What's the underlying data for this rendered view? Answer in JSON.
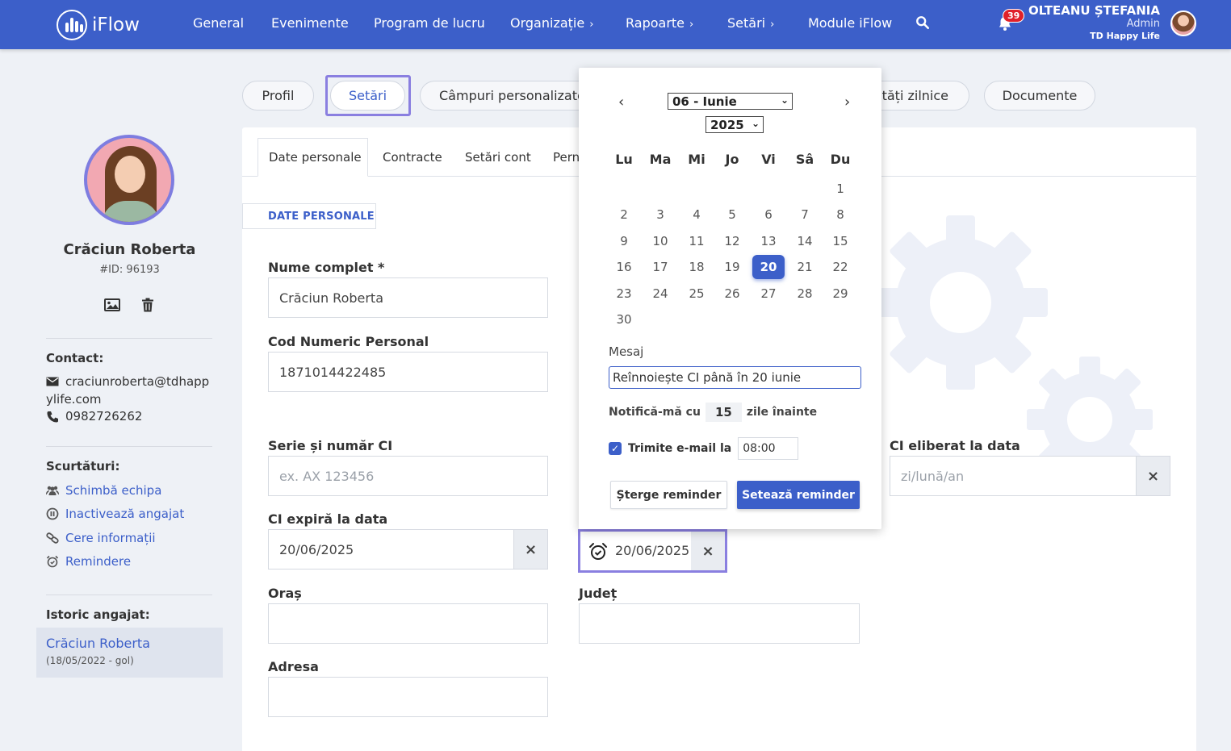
{
  "app": {
    "name": "iFlow"
  },
  "nav": {
    "items": [
      {
        "label": "General"
      },
      {
        "label": "Evenimente"
      },
      {
        "label": "Program de lucru"
      },
      {
        "label": "Organizație"
      },
      {
        "label": "Rapoarte"
      },
      {
        "label": "Setări"
      },
      {
        "label": "Module iFlow"
      }
    ],
    "chevron": "›",
    "notifications_count": "39"
  },
  "user": {
    "name": "OLTEANU ȘTEFANIA",
    "role": "Admin",
    "company": "TD Happy Life"
  },
  "top_tabs": [
    {
      "label": "Profil"
    },
    {
      "label": "Setări"
    },
    {
      "label": "Câmpuri personalizate"
    },
    {
      "label": "ități zilnice"
    },
    {
      "label": "Documente"
    }
  ],
  "profile": {
    "name": "Crăciun Roberta",
    "id": "#ID: 96193",
    "contact_heading": "Contact:",
    "email_line1": "craciunroberta@tdhapp",
    "email_line2": "ylife.com",
    "phone": "0982726262",
    "shortcuts_heading": "Scurtături:",
    "shortcuts": [
      {
        "label": "Schimbă echipa",
        "icon": "users-icon"
      },
      {
        "label": "Inactivează angajat",
        "icon": "pause-icon"
      },
      {
        "label": "Cere informații",
        "icon": "link-icon"
      },
      {
        "label": "Remindere",
        "icon": "alarm-icon"
      }
    ],
    "history_heading": "Istoric angajat:",
    "history_name": "Crăciun Roberta",
    "history_period": "(18/05/2022 - gol)"
  },
  "sub_tabs": [
    {
      "label": "Date personale"
    },
    {
      "label": "Contracte"
    },
    {
      "label": "Setări cont"
    },
    {
      "label": "Pern"
    }
  ],
  "section_label": "DATE PERSONALE",
  "form": {
    "full_name_label": "Nume complet *",
    "full_name_value": "Crăciun Roberta",
    "cnp_label": "Cod Numeric Personal",
    "cnp_value": "1871014422485",
    "ci_label": "Serie și număr CI",
    "ci_placeholder": "ex. AX 123456",
    "ci_issued_label": "CI eliberat la data",
    "ci_issued_placeholder": "zi/lună/an",
    "ci_expiry_label": "CI expiră la data",
    "ci_expiry_value": "20/06/2025",
    "reminder_value": "20/06/2025",
    "city_label": "Oraș",
    "city_value": "",
    "county_label": "Județ",
    "county_value": "",
    "address_label": "Adresa",
    "address_value": "",
    "clear": "×"
  },
  "calendar": {
    "prev": "‹",
    "next": "›",
    "month_select": "06 - Iunie",
    "year_select": "2025",
    "weekdays": [
      "Lu",
      "Ma",
      "Mi",
      "Jo",
      "Vi",
      "Sâ",
      "Du"
    ],
    "days": [
      {
        "d": "1"
      },
      {
        "d": "2"
      },
      {
        "d": "3"
      },
      {
        "d": "4"
      },
      {
        "d": "5"
      },
      {
        "d": "6"
      },
      {
        "d": "7"
      },
      {
        "d": "8"
      },
      {
        "d": "9"
      },
      {
        "d": "10"
      },
      {
        "d": "11"
      },
      {
        "d": "12"
      },
      {
        "d": "13"
      },
      {
        "d": "14"
      },
      {
        "d": "15"
      },
      {
        "d": "16"
      },
      {
        "d": "17"
      },
      {
        "d": "18"
      },
      {
        "d": "19"
      },
      {
        "d": "20"
      },
      {
        "d": "21"
      },
      {
        "d": "22"
      },
      {
        "d": "23"
      },
      {
        "d": "24"
      },
      {
        "d": "25"
      },
      {
        "d": "26"
      },
      {
        "d": "27"
      },
      {
        "d": "28"
      },
      {
        "d": "29"
      },
      {
        "d": "30"
      }
    ],
    "selected_day": "20",
    "message_label": "Mesaj",
    "message_value": "Reînnoiește CI până în 20 iunie",
    "notify_before": "Notifică-mă cu",
    "notify_days": "15",
    "notify_after": "zile înainte",
    "email_checked": true,
    "email_label": "Trimite e-mail la",
    "email_time": "08:00",
    "delete_label": "Șterge reminder",
    "set_label": "Setează reminder"
  },
  "colors": {
    "primary": "#3c5fc9",
    "highlight": "#8a7fe0",
    "badge": "#e0202a"
  }
}
